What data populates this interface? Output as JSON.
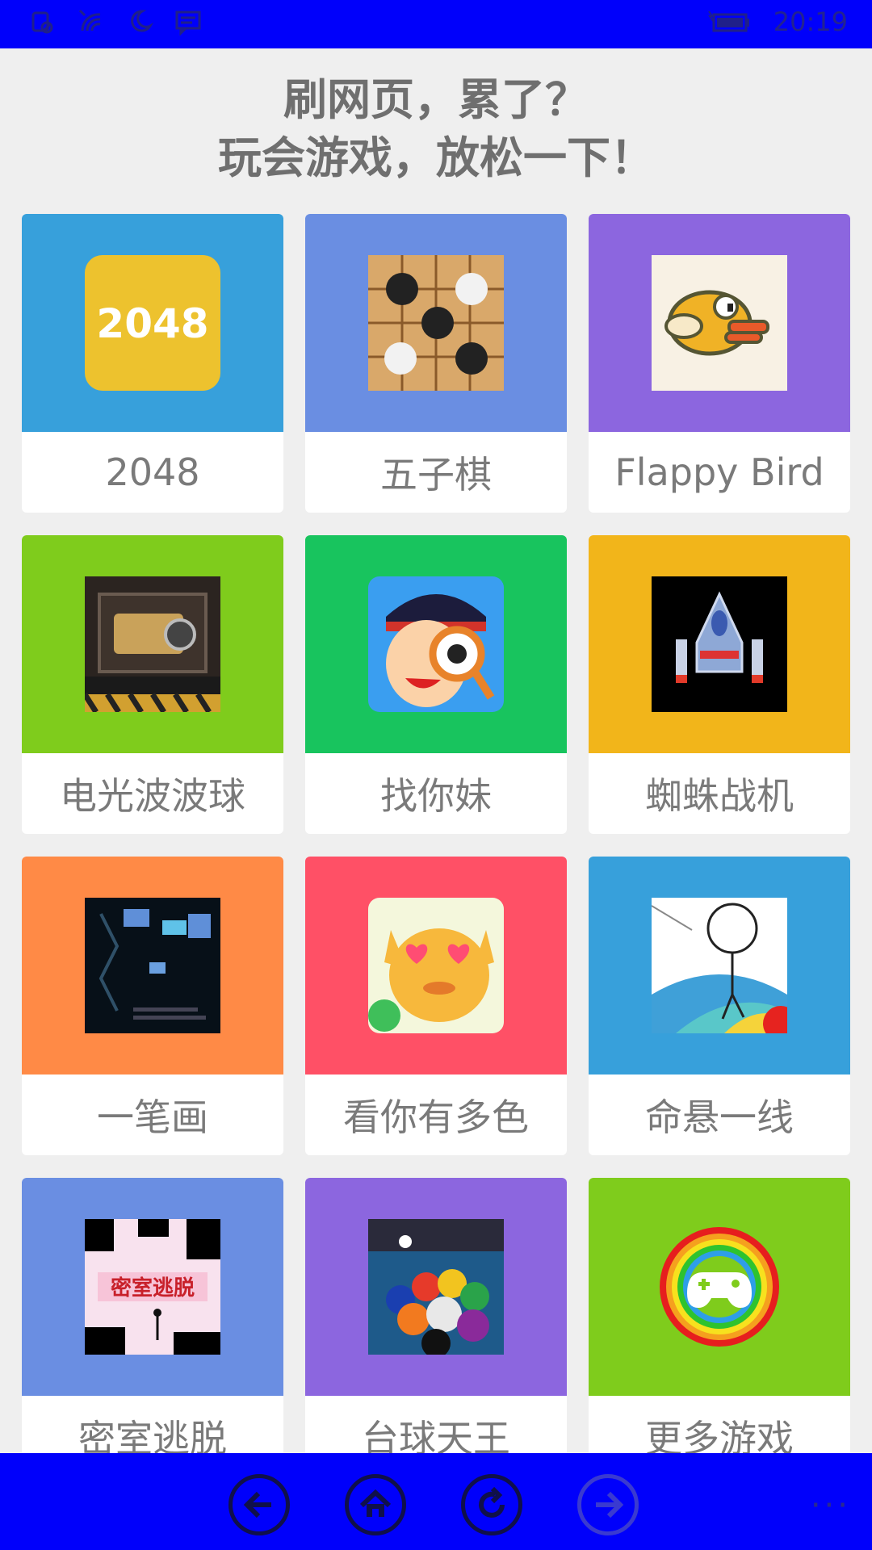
{
  "status_bar": {
    "time": "20:19",
    "icons": [
      "sim-icon",
      "signal-icon",
      "wifi-icon",
      "moon-icon",
      "message-icon",
      "battery-icon"
    ]
  },
  "heading": {
    "line1": "刷网页，累了？",
    "line2": "玩会游戏，放松一下！"
  },
  "games": [
    {
      "label": "2048",
      "color": "#37a0db",
      "icon": "game-2048-icon"
    },
    {
      "label": "五子棋",
      "color": "#6a8ee2",
      "icon": "gomoku-board-icon"
    },
    {
      "label": "Flappy Bird",
      "color": "#8c66df",
      "icon": "flappy-bird-icon"
    },
    {
      "label": "电光波波球",
      "color": "#7fcc1c",
      "icon": "electric-ball-icon"
    },
    {
      "label": "找你妹",
      "color": "#18c45e",
      "icon": "find-sister-icon"
    },
    {
      "label": "蜘蛛战机",
      "color": "#f2b51a",
      "icon": "spider-fighter-icon"
    },
    {
      "label": "一笔画",
      "color": "#ff8a46",
      "icon": "one-stroke-icon"
    },
    {
      "label": "看你有多色",
      "color": "#ff5066",
      "icon": "color-test-icon"
    },
    {
      "label": "命悬一线",
      "color": "#37a0db",
      "icon": "hanging-line-icon"
    },
    {
      "label": "密室逃脱",
      "color": "#6a8ee2",
      "icon": "escape-room-icon"
    },
    {
      "label": "台球天王",
      "color": "#8c66df",
      "icon": "billiards-icon"
    },
    {
      "label": "更多游戏",
      "color": "#7fcc1c",
      "icon": "more-games-controller-icon"
    }
  ],
  "nav_bar": {
    "buttons": [
      "back-arrow-icon",
      "home-icon",
      "refresh-icon",
      "forward-arrow-icon"
    ],
    "more_label": "···"
  },
  "colors": {
    "chrome_blue": "#0000fb",
    "page_bg": "#efefef",
    "label_text": "#7a7a7a",
    "heading_text": "#6f6f6f"
  }
}
